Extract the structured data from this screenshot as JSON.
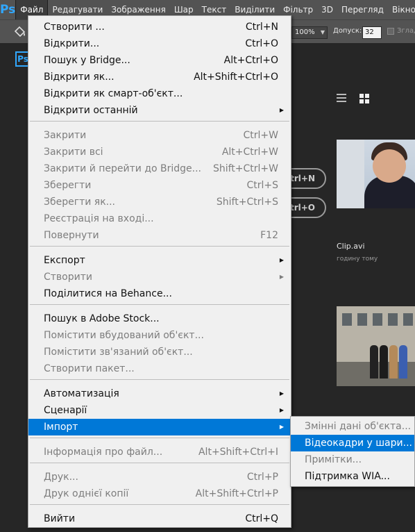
{
  "app": {
    "logo": "Ps",
    "badge": "Ps"
  },
  "menubar": {
    "items": [
      "Файл",
      "Редагувати",
      "Зображення",
      "Шар",
      "Текст",
      "Виділити",
      "Фільтр",
      "3D",
      "Перегляд",
      "Вікно"
    ]
  },
  "options": {
    "opacity_value": "100%",
    "tolerance_label": "Допуск:",
    "tolerance_value": "32",
    "antialias_label": "Зглад"
  },
  "workspace": {
    "pill1": "trl+N",
    "pill2": "trl+O",
    "clip_name": "Clip.avi",
    "clip_time": "годину тому"
  },
  "file_menu": {
    "items": [
      {
        "label": "Створити ...",
        "shortcut": "Ctrl+N",
        "disabled": false
      },
      {
        "label": "Відкрити...",
        "shortcut": "Ctrl+O",
        "disabled": false
      },
      {
        "label": "Пошук у Bridge...",
        "shortcut": "Alt+Ctrl+O",
        "disabled": false
      },
      {
        "label": "Відкрити як...",
        "shortcut": "Alt+Shift+Ctrl+O",
        "disabled": false
      },
      {
        "label": "Відкрити як смарт-об'єкт...",
        "shortcut": "",
        "disabled": false
      },
      {
        "label": "Відкрити останній",
        "shortcut": "",
        "disabled": false,
        "submenu": true
      },
      {
        "label": "Закрити",
        "shortcut": "Ctrl+W",
        "disabled": true
      },
      {
        "label": "Закрити всі",
        "shortcut": "Alt+Ctrl+W",
        "disabled": true
      },
      {
        "label": "Закрити й перейти до Bridge...",
        "shortcut": "Shift+Ctrl+W",
        "disabled": true
      },
      {
        "label": "Зберегти",
        "shortcut": "Ctrl+S",
        "disabled": true
      },
      {
        "label": "Зберегти як...",
        "shortcut": "Shift+Ctrl+S",
        "disabled": true
      },
      {
        "label": "Реєстрація на вході...",
        "shortcut": "",
        "disabled": true
      },
      {
        "label": "Повернути",
        "shortcut": "F12",
        "disabled": true
      },
      {
        "label": "Експорт",
        "shortcut": "",
        "disabled": false,
        "submenu": true
      },
      {
        "label": "Створити",
        "shortcut": "",
        "disabled": true,
        "submenu": true
      },
      {
        "label": "Поділитися на Behance...",
        "shortcut": "",
        "disabled": false
      },
      {
        "label": "Пошук в Adobe Stock...",
        "shortcut": "",
        "disabled": false
      },
      {
        "label": "Помістити вбудований об'єкт...",
        "shortcut": "",
        "disabled": true
      },
      {
        "label": "Помістити зв'язаний об'єкт...",
        "shortcut": "",
        "disabled": true
      },
      {
        "label": "Створити пакет...",
        "shortcut": "",
        "disabled": true
      },
      {
        "label": "Автоматизація",
        "shortcut": "",
        "disabled": false,
        "submenu": true
      },
      {
        "label": "Сценарії",
        "shortcut": "",
        "disabled": false,
        "submenu": true
      },
      {
        "label": "Імпорт",
        "shortcut": "",
        "disabled": false,
        "submenu": true,
        "highlight": true
      },
      {
        "label": "Інформація про файл...",
        "shortcut": "Alt+Shift+Ctrl+I",
        "disabled": true
      },
      {
        "label": "Друк...",
        "shortcut": "Ctrl+P",
        "disabled": true
      },
      {
        "label": "Друк однієї копії",
        "shortcut": "Alt+Shift+Ctrl+P",
        "disabled": true
      },
      {
        "label": "Вийти",
        "shortcut": "Ctrl+Q",
        "disabled": false
      }
    ]
  },
  "import_submenu": {
    "items": [
      {
        "label": "Змінні дані об'єкта...",
        "disabled": true
      },
      {
        "label": "Відеокадри у шари...",
        "disabled": false,
        "highlight": true
      },
      {
        "label": "Примітки...",
        "disabled": true
      },
      {
        "label": "Підтримка WIA...",
        "disabled": false
      }
    ]
  }
}
